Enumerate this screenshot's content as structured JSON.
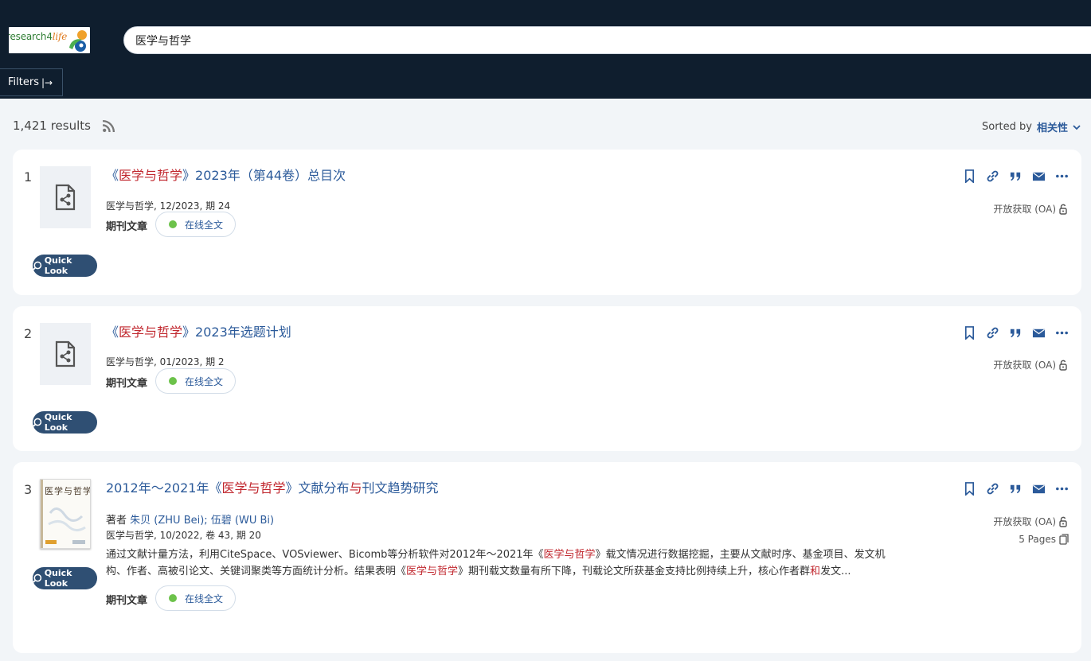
{
  "header": {
    "logo": {
      "text_main": "research4",
      "text_life": "life"
    },
    "search": {
      "value": "医学与哲学",
      "placeholder": ""
    },
    "filters_label": "Filters"
  },
  "toolbar": {
    "results_count": "1,421 results",
    "sorted_label": "Sorted by",
    "sorted_value": "相关性"
  },
  "results": [
    {
      "number": "1",
      "title_pre": "《",
      "title_hl": "医学与哲学",
      "title_post": "》2023年（第44卷）总目次",
      "meta": "医学与哲学, 12/2023, 期 24",
      "type": "期刊文章",
      "fulltext": "在线全文",
      "quick_look": "Quick Look",
      "access": "开放获取 (OA)"
    },
    {
      "number": "2",
      "title_pre": "《",
      "title_hl": "医学与哲学",
      "title_post": "》2023年选题计划",
      "meta": "医学与哲学, 01/2023, 期 2",
      "type": "期刊文章",
      "fulltext": "在线全文",
      "quick_look": "Quick Look",
      "access": "开放获取 (OA)"
    },
    {
      "number": "3",
      "title_pre": "2012年～2021年《",
      "title_hl": "医学与哲学",
      "title_mid": "》文献分布",
      "title_hl2": "与",
      "title_post": "刊文趋势研究",
      "authors_label": "著者",
      "authors": "朱贝 (ZHU Bei); 伍碧 (WU Bi)",
      "meta": "医学与哲学, 10/2022, 卷 43, 期 20",
      "abstract_1a": "通过文献计量方法，利用CiteSpace、VOSviewer、Bicomb等分析软件对2012年～2021年《",
      "abstract_1hl": "医学与哲学",
      "abstract_1b": "》载文情况进行数据挖掘，主要从文献时序、基金项目、发文机",
      "abstract_2a": "构、作者、高被引论文、关键词聚类等方面统计分析。结果表明《",
      "abstract_2hl": "医学与哲学",
      "abstract_2b": "》期刊载文数量有所下降，刊载论文所获基金支持比例持续上升，核心作者群",
      "abstract_2hl2": "和",
      "abstract_2c": "发文...",
      "type": "期刊文章",
      "fulltext": "在线全文",
      "quick_look": "Quick Look",
      "access": "开放获取 (OA)",
      "pages": "5 Pages",
      "cover_title": "医学与哲学"
    }
  ],
  "colors": {
    "header_bg": "#0f1e2e",
    "link": "#2b5a9a",
    "highlight": "#c0262d",
    "quick_look_bg": "#2f4f73",
    "fulltext_dot": "#6cc24a"
  }
}
